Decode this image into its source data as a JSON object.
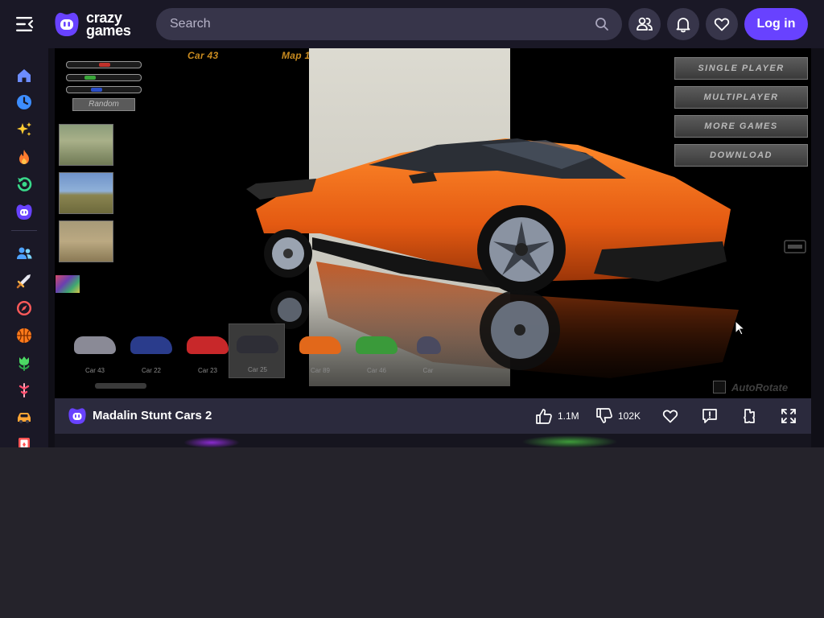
{
  "header": {
    "logo_line1": "crazy",
    "logo_line2": "games",
    "search_placeholder": "Search",
    "login_label": "Log in",
    "icons": [
      "menu-collapse-icon",
      "friends-icon",
      "bell-icon",
      "heart-icon",
      "search-icon"
    ]
  },
  "sidebar": {
    "items": [
      {
        "name": "home",
        "icon": "home-icon",
        "color": "#6c8cff"
      },
      {
        "name": "recent",
        "icon": "clock-icon",
        "color": "#3d8dff"
      },
      {
        "name": "new",
        "icon": "sparkle-icon",
        "color": "#ffcc33"
      },
      {
        "name": "trending",
        "icon": "fire-icon",
        "color": "#ff7b2e"
      },
      {
        "name": "updated",
        "icon": "refresh-icon",
        "color": "#39d98a"
      },
      {
        "name": "originals",
        "icon": "crazygames-icon",
        "color": "#6842ff"
      },
      {
        "name": "multiplayer",
        "icon": "people-icon",
        "color": "#4ea3ff"
      },
      {
        "name": "action",
        "icon": "sword-icon",
        "color": "#ffb347"
      },
      {
        "name": "adventure",
        "icon": "compass-icon",
        "color": "#ff5a5a"
      },
      {
        "name": "basketball",
        "icon": "basketball-icon",
        "color": "#ff7a1a"
      },
      {
        "name": "beauty",
        "icon": "tulip-icon",
        "color": "#4cd964"
      },
      {
        "name": "bike",
        "icon": "bike-icon",
        "color": "#ff4d6d"
      },
      {
        "name": "car",
        "icon": "car-icon",
        "color": "#ffa534"
      },
      {
        "name": "card",
        "icon": "card-icon",
        "color": "#ff5252"
      }
    ]
  },
  "game": {
    "title": "Madalin Stunt Cars 2",
    "likes": "1.1M",
    "dislikes": "102K",
    "hud": {
      "car_label": "Car 43",
      "map_label": "Map 1",
      "random_label": "Random",
      "menu_buttons": [
        "SINGLE PLAYER",
        "MULTIPLAYER",
        "MORE GAMES",
        "DOWNLOAD"
      ],
      "autorotate_label": "AutoRotate",
      "cars": [
        {
          "label": "Car 43",
          "color": "#8a8a96"
        },
        {
          "label": "Car 22",
          "color": "#2a3c8c"
        },
        {
          "label": "Car 23",
          "color": "#c8282a"
        },
        {
          "label": "Car 25",
          "color": "#2e2e36"
        },
        {
          "label": "Car 89",
          "color": "#e2681a"
        },
        {
          "label": "Car 46",
          "color": "#3a9a3a"
        },
        {
          "label": "Car",
          "color": "#4a4a60"
        }
      ]
    }
  },
  "colors": {
    "brand": "#6842ff",
    "topbar": "#1a1826",
    "car_body": "#f26a17"
  }
}
